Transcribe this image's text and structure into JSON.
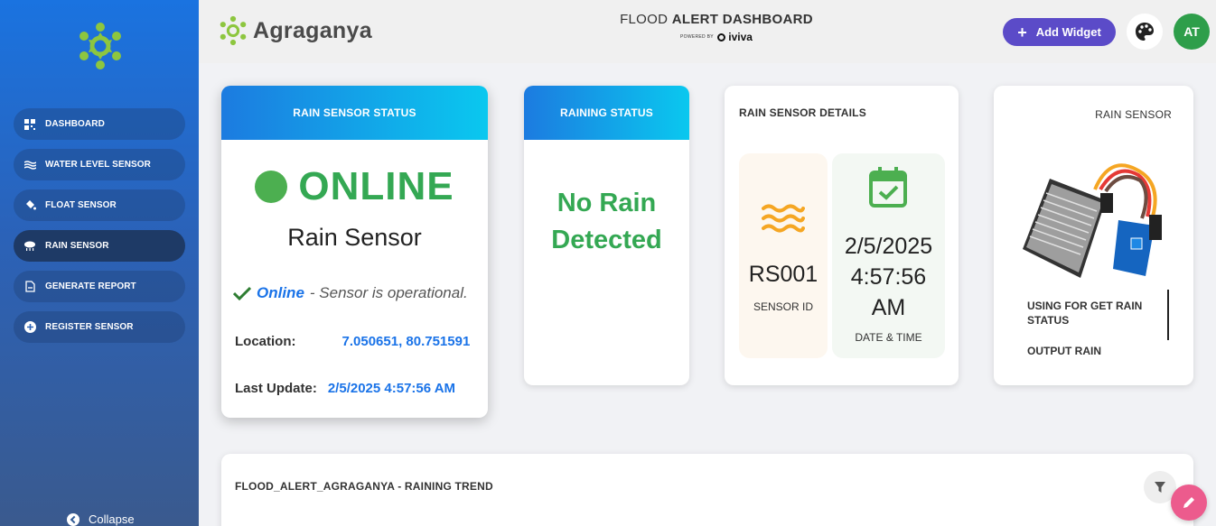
{
  "sidebar": {
    "items": [
      {
        "label": "DASHBOARD",
        "icon": "qr-grid-icon",
        "active": false
      },
      {
        "label": "WATER LEVEL SENSOR",
        "icon": "waves-icon",
        "active": false
      },
      {
        "label": "FLOAT SENSOR",
        "icon": "paint-bucket-icon",
        "active": false
      },
      {
        "label": "RAIN SENSOR",
        "icon": "rain-cloud-icon",
        "active": true
      },
      {
        "label": "GENERATE REPORT",
        "icon": "file-icon",
        "active": false
      },
      {
        "label": "REGISTER SENSOR",
        "icon": "plus-circle-icon",
        "active": false
      }
    ],
    "collapse_label": "Collapse"
  },
  "header": {
    "brand_name": "Agraganya",
    "title_light": "FLOOD",
    "title_bold": "ALERT DASHBOARD",
    "powered_by": "POWERED BY",
    "powered_brand": "iviva",
    "add_widget_label": "Add Widget",
    "avatar_initials": "AT"
  },
  "cards": {
    "status": {
      "header": "RAIN SENSOR STATUS",
      "state": "ONLINE",
      "sensor_name": "Rain Sensor",
      "op_strong": "Online",
      "op_text": "- Sensor is operational.",
      "location_label": "Location:",
      "location_value": "7.050651, 80.751591",
      "last_update_label": "Last Update:",
      "last_update_value": "2/5/2025 4:57:56 AM"
    },
    "raining": {
      "header": "RAINING STATUS",
      "line1": "No Rain",
      "line2": "Detected"
    },
    "details": {
      "header": "RAIN SENSOR DETAILS",
      "sensor_id": "RS001",
      "sensor_id_label": "SENSOR ID",
      "date_line1": "2/5/2025",
      "date_line2": "4:57:56",
      "date_line3": "AM",
      "date_label": "DATE & TIME"
    },
    "image": {
      "header": "RAIN SENSOR",
      "desc_line1": "USING FOR GET RAIN",
      "desc_line2": "STATUS",
      "desc_line3": "OUTPUT RAIN"
    },
    "trend": {
      "header": "FLOOD_ALERT_AGRAGANYA - RAINING TREND"
    }
  },
  "colors": {
    "online_green": "#34a853",
    "link_blue": "#1a73e8",
    "accent_purple": "#5b4bc8",
    "avatar_green": "#2e9e4a",
    "fab_pink": "#ec5b8d"
  }
}
